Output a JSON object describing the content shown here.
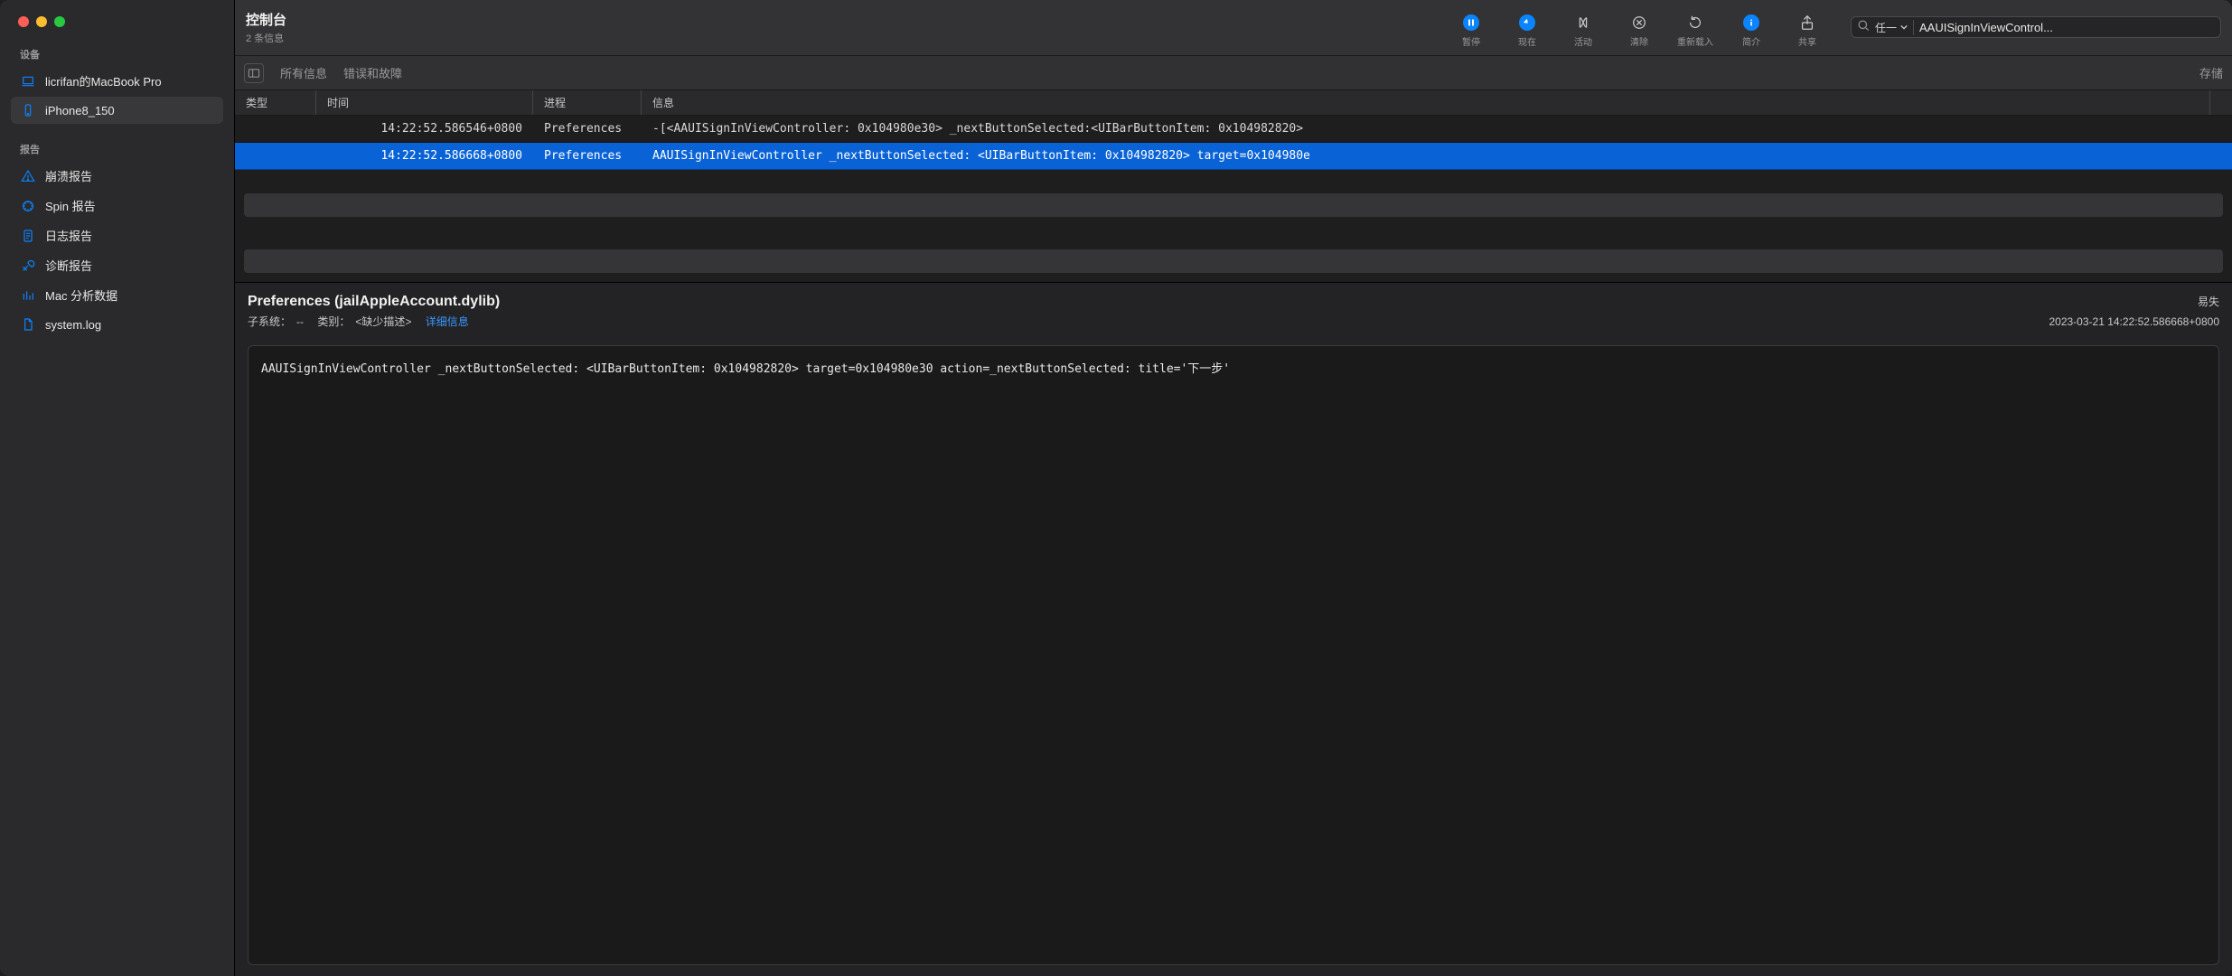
{
  "window": {
    "title": "控制台",
    "subtitle": "2 条信息"
  },
  "toolbar": {
    "pause": "暂停",
    "now": "现在",
    "activity": "活动",
    "clear": "清除",
    "reload": "重新载入",
    "info": "简介",
    "share": "共享"
  },
  "search": {
    "scope": "任一",
    "value": "AAUISignInViewControl..."
  },
  "filter": {
    "all": "所有信息",
    "errors": "错误和故障",
    "save": "存储"
  },
  "columns": {
    "type": "类型",
    "time": "时间",
    "process": "进程",
    "message": "信息"
  },
  "rows": [
    {
      "time": "14:22:52.586546+0800",
      "process": "Preferences",
      "message": "-[<AAUISignInViewController: 0x104980e30> _nextButtonSelected:<UIBarButtonItem: 0x104982820>",
      "selected": false
    },
    {
      "time": "14:22:52.586668+0800",
      "process": "Preferences",
      "message": "AAUISignInViewController _nextButtonSelected: <UIBarButtonItem: 0x104982820> target=0x104980e",
      "selected": true
    }
  ],
  "detail": {
    "title": "Preferences (jailAppleAccount.dylib)",
    "subsystem_label": "子系统：",
    "subsystem": "--",
    "category_label": "类别：",
    "category": "<缺少描述>",
    "detail_link": "详细信息",
    "volatile": "易失",
    "timestamp": "2023-03-21 14:22:52.586668+0800",
    "body": "AAUISignInViewController _nextButtonSelected: <UIBarButtonItem: 0x104982820> target=0x104980e30 action=_nextButtonSelected: title='下一步'"
  },
  "sidebar": {
    "devices_label": "设备",
    "devices": [
      {
        "name": "licrifan的MacBook Pro",
        "icon": "laptop"
      },
      {
        "name": "iPhone8_150",
        "icon": "phone",
        "selected": true
      }
    ],
    "reports_label": "报告",
    "reports": [
      {
        "name": "崩溃报告",
        "icon": "warning"
      },
      {
        "name": "Spin 报告",
        "icon": "spinner"
      },
      {
        "name": "日志报告",
        "icon": "doc-text"
      },
      {
        "name": "诊断报告",
        "icon": "wrench"
      },
      {
        "name": "Mac 分析数据",
        "icon": "chart"
      },
      {
        "name": "system.log",
        "icon": "doc"
      }
    ]
  }
}
